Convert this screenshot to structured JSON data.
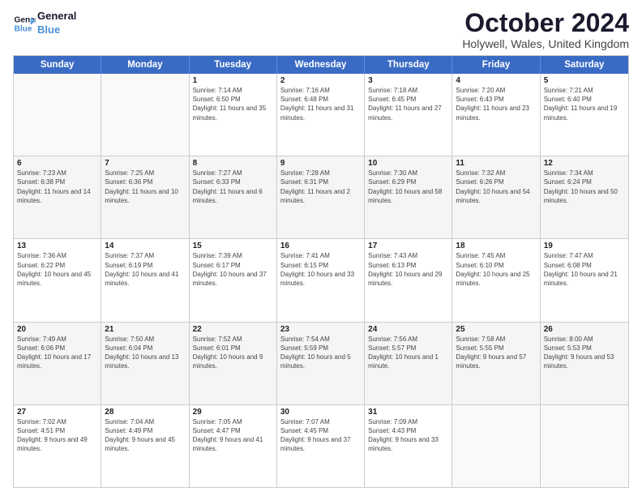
{
  "logo": {
    "line1": "General",
    "line2": "Blue",
    "arrow_color": "#4a90d9"
  },
  "header": {
    "month": "October 2024",
    "location": "Holywell, Wales, United Kingdom"
  },
  "weekdays": [
    "Sunday",
    "Monday",
    "Tuesday",
    "Wednesday",
    "Thursday",
    "Friday",
    "Saturday"
  ],
  "weeks": [
    [
      {
        "day": "",
        "sunrise": "",
        "sunset": "",
        "daylight": "",
        "empty": true
      },
      {
        "day": "",
        "sunrise": "",
        "sunset": "",
        "daylight": "",
        "empty": true
      },
      {
        "day": "1",
        "sunrise": "Sunrise: 7:14 AM",
        "sunset": "Sunset: 6:50 PM",
        "daylight": "Daylight: 11 hours and 35 minutes."
      },
      {
        "day": "2",
        "sunrise": "Sunrise: 7:16 AM",
        "sunset": "Sunset: 6:48 PM",
        "daylight": "Daylight: 11 hours and 31 minutes."
      },
      {
        "day": "3",
        "sunrise": "Sunrise: 7:18 AM",
        "sunset": "Sunset: 6:45 PM",
        "daylight": "Daylight: 11 hours and 27 minutes."
      },
      {
        "day": "4",
        "sunrise": "Sunrise: 7:20 AM",
        "sunset": "Sunset: 6:43 PM",
        "daylight": "Daylight: 11 hours and 23 minutes."
      },
      {
        "day": "5",
        "sunrise": "Sunrise: 7:21 AM",
        "sunset": "Sunset: 6:40 PM",
        "daylight": "Daylight: 11 hours and 19 minutes."
      }
    ],
    [
      {
        "day": "6",
        "sunrise": "Sunrise: 7:23 AM",
        "sunset": "Sunset: 6:38 PM",
        "daylight": "Daylight: 11 hours and 14 minutes."
      },
      {
        "day": "7",
        "sunrise": "Sunrise: 7:25 AM",
        "sunset": "Sunset: 6:36 PM",
        "daylight": "Daylight: 11 hours and 10 minutes."
      },
      {
        "day": "8",
        "sunrise": "Sunrise: 7:27 AM",
        "sunset": "Sunset: 6:33 PM",
        "daylight": "Daylight: 11 hours and 6 minutes."
      },
      {
        "day": "9",
        "sunrise": "Sunrise: 7:28 AM",
        "sunset": "Sunset: 6:31 PM",
        "daylight": "Daylight: 11 hours and 2 minutes."
      },
      {
        "day": "10",
        "sunrise": "Sunrise: 7:30 AM",
        "sunset": "Sunset: 6:29 PM",
        "daylight": "Daylight: 10 hours and 58 minutes."
      },
      {
        "day": "11",
        "sunrise": "Sunrise: 7:32 AM",
        "sunset": "Sunset: 6:26 PM",
        "daylight": "Daylight: 10 hours and 54 minutes."
      },
      {
        "day": "12",
        "sunrise": "Sunrise: 7:34 AM",
        "sunset": "Sunset: 6:24 PM",
        "daylight": "Daylight: 10 hours and 50 minutes."
      }
    ],
    [
      {
        "day": "13",
        "sunrise": "Sunrise: 7:36 AM",
        "sunset": "Sunset: 6:22 PM",
        "daylight": "Daylight: 10 hours and 45 minutes."
      },
      {
        "day": "14",
        "sunrise": "Sunrise: 7:37 AM",
        "sunset": "Sunset: 6:19 PM",
        "daylight": "Daylight: 10 hours and 41 minutes."
      },
      {
        "day": "15",
        "sunrise": "Sunrise: 7:39 AM",
        "sunset": "Sunset: 6:17 PM",
        "daylight": "Daylight: 10 hours and 37 minutes."
      },
      {
        "day": "16",
        "sunrise": "Sunrise: 7:41 AM",
        "sunset": "Sunset: 6:15 PM",
        "daylight": "Daylight: 10 hours and 33 minutes."
      },
      {
        "day": "17",
        "sunrise": "Sunrise: 7:43 AM",
        "sunset": "Sunset: 6:13 PM",
        "daylight": "Daylight: 10 hours and 29 minutes."
      },
      {
        "day": "18",
        "sunrise": "Sunrise: 7:45 AM",
        "sunset": "Sunset: 6:10 PM",
        "daylight": "Daylight: 10 hours and 25 minutes."
      },
      {
        "day": "19",
        "sunrise": "Sunrise: 7:47 AM",
        "sunset": "Sunset: 6:08 PM",
        "daylight": "Daylight: 10 hours and 21 minutes."
      }
    ],
    [
      {
        "day": "20",
        "sunrise": "Sunrise: 7:49 AM",
        "sunset": "Sunset: 6:06 PM",
        "daylight": "Daylight: 10 hours and 17 minutes."
      },
      {
        "day": "21",
        "sunrise": "Sunrise: 7:50 AM",
        "sunset": "Sunset: 6:04 PM",
        "daylight": "Daylight: 10 hours and 13 minutes."
      },
      {
        "day": "22",
        "sunrise": "Sunrise: 7:52 AM",
        "sunset": "Sunset: 6:01 PM",
        "daylight": "Daylight: 10 hours and 9 minutes."
      },
      {
        "day": "23",
        "sunrise": "Sunrise: 7:54 AM",
        "sunset": "Sunset: 5:59 PM",
        "daylight": "Daylight: 10 hours and 5 minutes."
      },
      {
        "day": "24",
        "sunrise": "Sunrise: 7:56 AM",
        "sunset": "Sunset: 5:57 PM",
        "daylight": "Daylight: 10 hours and 1 minute."
      },
      {
        "day": "25",
        "sunrise": "Sunrise: 7:58 AM",
        "sunset": "Sunset: 5:55 PM",
        "daylight": "Daylight: 9 hours and 57 minutes."
      },
      {
        "day": "26",
        "sunrise": "Sunrise: 8:00 AM",
        "sunset": "Sunset: 5:53 PM",
        "daylight": "Daylight: 9 hours and 53 minutes."
      }
    ],
    [
      {
        "day": "27",
        "sunrise": "Sunrise: 7:02 AM",
        "sunset": "Sunset: 4:51 PM",
        "daylight": "Daylight: 9 hours and 49 minutes."
      },
      {
        "day": "28",
        "sunrise": "Sunrise: 7:04 AM",
        "sunset": "Sunset: 4:49 PM",
        "daylight": "Daylight: 9 hours and 45 minutes."
      },
      {
        "day": "29",
        "sunrise": "Sunrise: 7:05 AM",
        "sunset": "Sunset: 4:47 PM",
        "daylight": "Daylight: 9 hours and 41 minutes."
      },
      {
        "day": "30",
        "sunrise": "Sunrise: 7:07 AM",
        "sunset": "Sunset: 4:45 PM",
        "daylight": "Daylight: 9 hours and 37 minutes."
      },
      {
        "day": "31",
        "sunrise": "Sunrise: 7:09 AM",
        "sunset": "Sunset: 4:43 PM",
        "daylight": "Daylight: 9 hours and 33 minutes."
      },
      {
        "day": "",
        "sunrise": "",
        "sunset": "",
        "daylight": "",
        "empty": true
      },
      {
        "day": "",
        "sunrise": "",
        "sunset": "",
        "daylight": "",
        "empty": true
      }
    ]
  ]
}
